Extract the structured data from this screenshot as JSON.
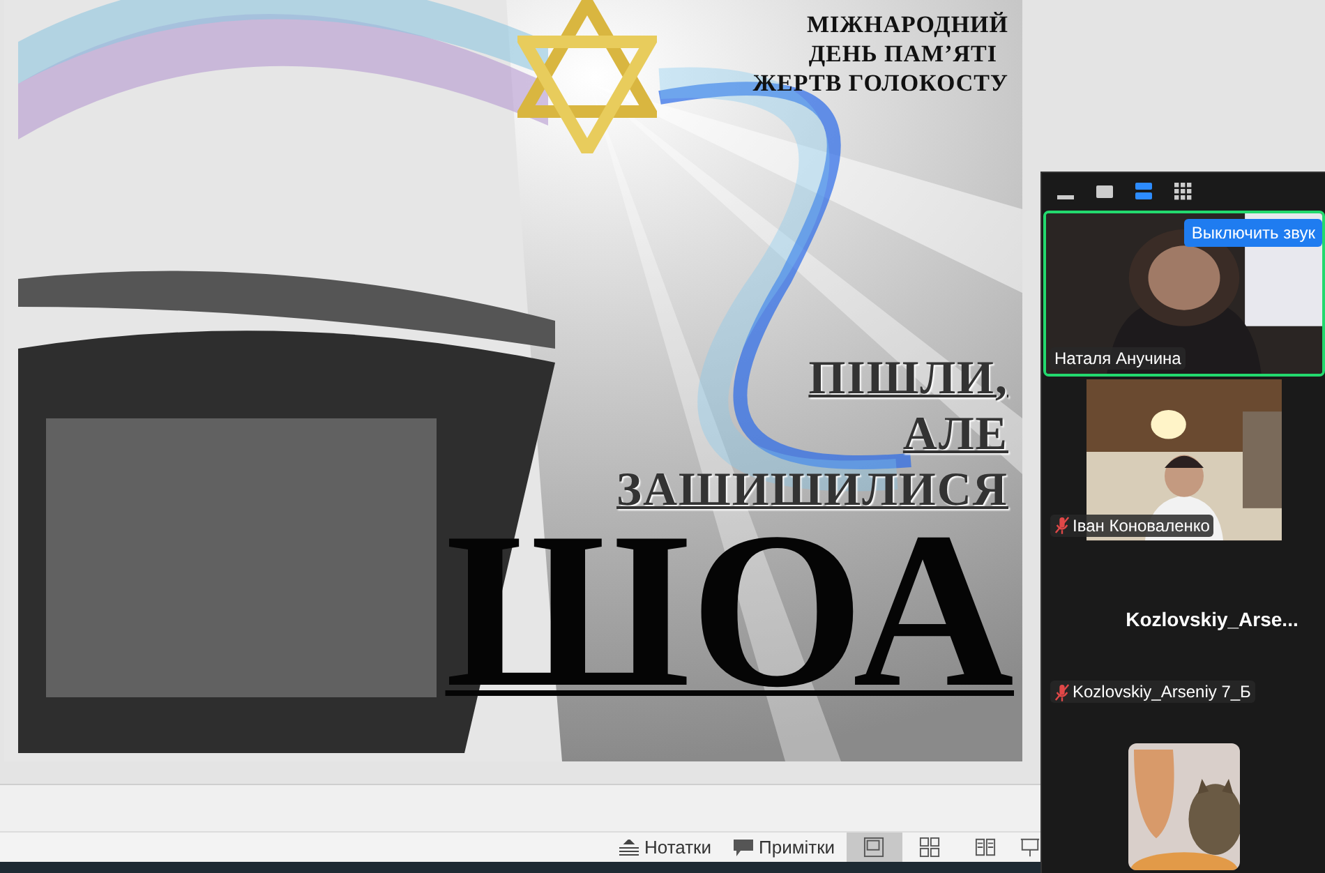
{
  "slide": {
    "header_lines": [
      "МІЖНАРОДНИЙ",
      "ДЕНЬ ПАМ’ЯТІ",
      "ЖЕРТВ ГОЛОКОСТУ"
    ],
    "subtitle_lines": [
      "ПІШЛИ,",
      "АЛЕ",
      "ЗАШИШИЛИСЯ"
    ],
    "title": "ШОА"
  },
  "status_bar": {
    "buttons": [
      {
        "kind": "notes",
        "label": "Нотатки"
      },
      {
        "kind": "comments",
        "label": "Примітки"
      }
    ],
    "views": [
      {
        "kind": "normal",
        "selected": true
      },
      {
        "kind": "sorter",
        "selected": false
      },
      {
        "kind": "reading",
        "selected": false
      },
      {
        "kind": "slideshow",
        "selected": false
      }
    ]
  },
  "meeting": {
    "view_modes": [
      {
        "kind": "minimize",
        "selected": false
      },
      {
        "kind": "thumbnail",
        "selected": false
      },
      {
        "kind": "speaker",
        "selected": true
      },
      {
        "kind": "gallery",
        "selected": false
      }
    ],
    "participants": [
      {
        "kind": "woman",
        "video": true,
        "speaking": true,
        "muted": false,
        "name": "Наталя Анучина",
        "mute_button": "Выключить звук"
      },
      {
        "kind": "kitchen",
        "video": true,
        "speaking": false,
        "muted": true,
        "name": "Іван Коноваленко"
      },
      {
        "kind": "none",
        "video": false,
        "speaking": false,
        "muted": true,
        "display_name": "Kozlovskiy_Arse...",
        "name": "Kozlovskiy_Arseniy 7_Б"
      },
      {
        "kind": "cat",
        "video": true,
        "speaking": false,
        "muted": false
      }
    ]
  }
}
